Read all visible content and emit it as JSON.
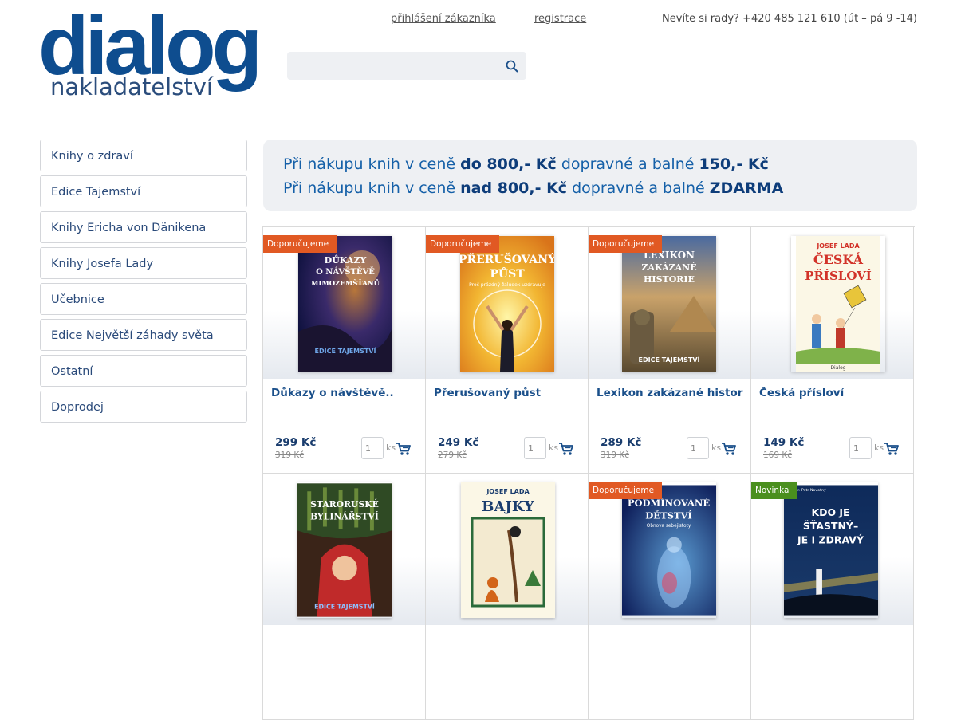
{
  "header": {
    "logo_main": "dialog",
    "logo_sub": "nakladatelství",
    "login_link": "přihlášení zákazníka",
    "register_link": "registrace",
    "contact": "Nevíte si rady? +420 485 121 610 (út – pá 9 -14)"
  },
  "search": {
    "placeholder": "",
    "icon": "search-icon"
  },
  "sidebar": {
    "items": [
      {
        "label": "Knihy o zdraví"
      },
      {
        "label": "Edice Tajemství"
      },
      {
        "label": "Knihy Ericha von Dänikena"
      },
      {
        "label": "Knihy Josefa Lady"
      },
      {
        "label": "Učebnice"
      },
      {
        "label": "Edice Největší záhady světa"
      },
      {
        "label": "Ostatní"
      },
      {
        "label": "Doprodej"
      }
    ]
  },
  "banner": {
    "line1": {
      "a": "Při nákupu knih v ceně ",
      "b": "do 800,- Kč",
      "c": " dopravné a balné ",
      "d": "150,- Kč"
    },
    "line2": {
      "a": "Při nákupu knih v ceně ",
      "b": "nad 800,- Kč",
      "c": " dopravné a balné ",
      "d": "ZDARMA"
    }
  },
  "colors": {
    "brand": "#0e4d8f",
    "badge_recommended": "#e15923",
    "badge_new": "#4a8f1e",
    "banner_bg": "#eef0f3"
  },
  "products": [
    {
      "badge": "Doporučujeme",
      "title": "Důkazy o návštěvě..",
      "price": "299 Kč",
      "old_price": "319 Kč",
      "qty": "1",
      "unit": "ks",
      "cover_text": "DŮKAZY O NÁVŠTĚVĚ MIMOZEMŠŤANŮ",
      "cover_sub": "EDICE TAJEMSTVÍ"
    },
    {
      "badge": "Doporučujeme",
      "title": "Přerušovaný půst",
      "price": "249 Kč",
      "old_price": "279 Kč",
      "qty": "1",
      "unit": "ks",
      "cover_text": "PŘERUŠOVANÝ PŮST",
      "cover_sub": "Proč prázdný žaludek uzdravuje"
    },
    {
      "badge": "Doporučujeme",
      "title": "Lexikon zakázané historie",
      "price": "289 Kč",
      "old_price": "319 Kč",
      "qty": "1",
      "unit": "ks",
      "cover_text": "LEXIKON ZAKÁZANÉ HISTORIE",
      "cover_sub": "EDICE TAJEMSTVÍ"
    },
    {
      "badge": "",
      "title": "Česká přísloví",
      "price": "149 Kč",
      "old_price": "169 Kč",
      "qty": "1",
      "unit": "ks",
      "cover_text": "ČESKÁ PŘÍSLOVÍ",
      "cover_sub": "JOSEF LADA"
    },
    {
      "badge": "",
      "title": "",
      "price": "",
      "old_price": "",
      "qty": "",
      "unit": "",
      "cover_text": "STARORUSKÉ BYLINÁŘSTVÍ",
      "cover_sub": "EDICE TAJEMSTVÍ"
    },
    {
      "badge": "",
      "title": "",
      "price": "",
      "old_price": "",
      "qty": "",
      "unit": "",
      "cover_text": "BAJKY",
      "cover_sub": "JOSEF LADA"
    },
    {
      "badge": "Doporučujeme",
      "title": "",
      "price": "",
      "old_price": "",
      "qty": "",
      "unit": "",
      "cover_text": "PODMÍNOVANÉ DĚTSTVÍ",
      "cover_sub": "Obnova sebejistoty"
    },
    {
      "badge": "Novinka",
      "title": "",
      "price": "",
      "old_price": "",
      "qty": "",
      "unit": "",
      "cover_text": "KDO JE ŠŤASTNÝ– JE I ZDRAVÝ",
      "cover_sub": "PhDr. Petr Novotný"
    }
  ]
}
